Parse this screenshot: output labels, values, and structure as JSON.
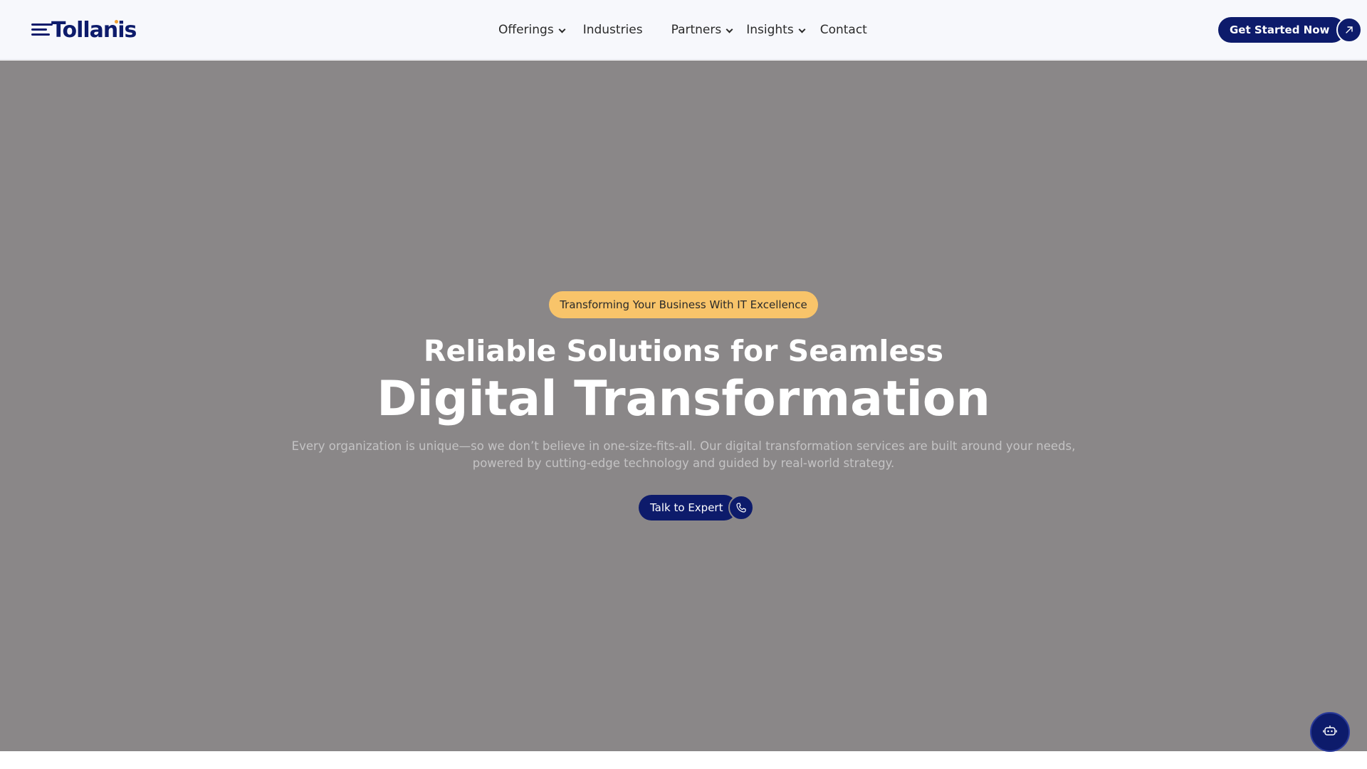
{
  "header": {
    "logo_text": "Tollanis",
    "nav": [
      {
        "label": "Offerings",
        "has_dropdown": true
      },
      {
        "label": "Industries",
        "has_dropdown": false
      },
      {
        "label": "Partners",
        "has_dropdown": true
      },
      {
        "label": "Insights",
        "has_dropdown": true
      },
      {
        "label": "Contact",
        "has_dropdown": false
      }
    ],
    "cta_label": "Get Started Now",
    "cta_icon": "arrow-up-right-icon"
  },
  "hero": {
    "badge": "Transforming Your Business With IT Excellence",
    "title_line1": "Reliable Solutions for Seamless",
    "title_line2": "Digital Transformation",
    "description_line1": "Every organization is unique—so we don’t believe in one-size-fits-all. Our digital transformation services are built around your needs,",
    "description_line2": "powered by cutting-edge technology and guided by real-world strategy.",
    "button_label": "Talk to Expert",
    "button_icon": "phone-icon"
  },
  "chatbot": {
    "icon": "robot-icon"
  },
  "colors": {
    "brand_navy": "#0d1b6b",
    "badge_yellow": "#f8c46a",
    "hero_overlay": "#8a8788",
    "logo_accent": "#f0a030"
  }
}
